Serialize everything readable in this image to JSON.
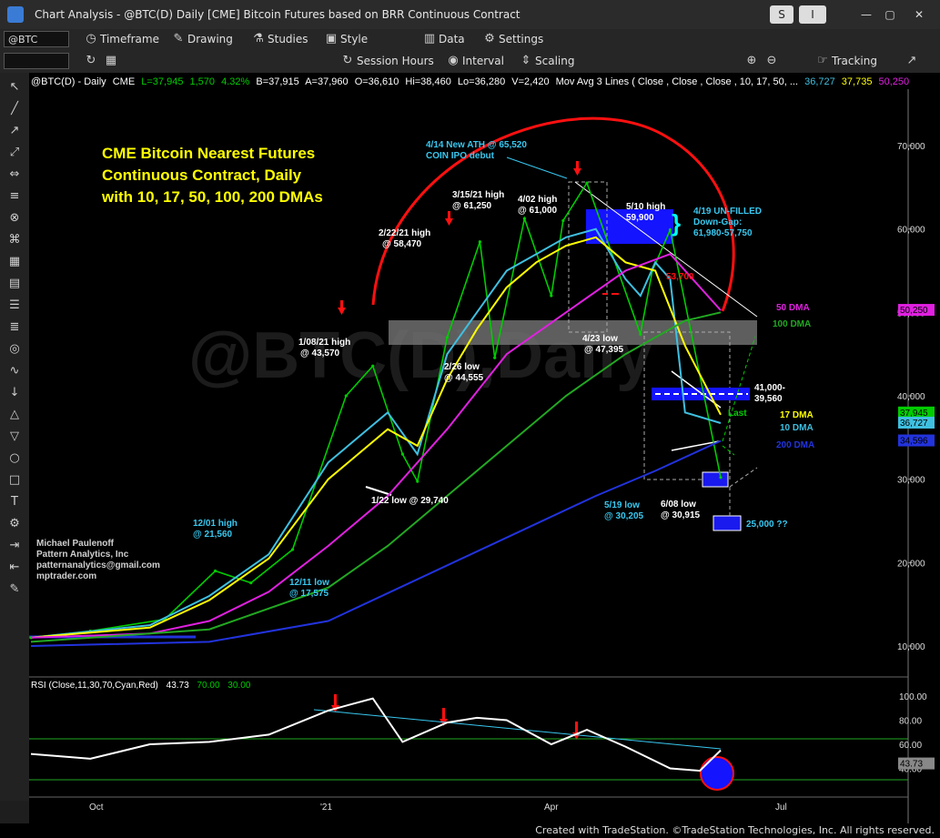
{
  "window": {
    "title": "Chart Analysis - @BTC(D) Daily [CME] Bitcoin Futures based on BRR Continuous Contract",
    "buttons": [
      "S",
      "I"
    ]
  },
  "toolbar1": {
    "symbol": "@BTC",
    "items": [
      "Timeframe",
      "Drawing",
      "Studies",
      "Style",
      "Data",
      "Settings"
    ]
  },
  "toolbar2": {
    "items": [
      "Session Hours",
      "Interval",
      "Scaling",
      "Tracking"
    ]
  },
  "header": {
    "symbol": "@BTC(D) - Daily",
    "exchange": "CME",
    "last": "L=37,945",
    "change": "1,570",
    "pct": "4.32%",
    "bid": "B=37,915",
    "ask": "A=37,960",
    "open": "O=36,610",
    "high": "Hi=38,460",
    "low": "Lo=36,280",
    "vol": "V=2,420",
    "ma_label": "Mov Avg 3 Lines ( Close , Close , Close , 10, 17, 50, ...",
    "ma_vals": [
      "36,727",
      "37,735",
      "50,250"
    ]
  },
  "watermark": "@BTC(D),Daily",
  "colors": {
    "background": "#000000",
    "price": "#00cc00",
    "ma10": "#3fbfe0",
    "ma17": "#ffff00",
    "ma50": "#e020e0",
    "ma100": "#22a822",
    "ma200": "#2233dd",
    "arc": "#ff0000",
    "annotation_white": "#ffffff",
    "annotation_cyan": "#38c8f0",
    "title_yellow": "#ffff00"
  },
  "chart_title": [
    "CME Bitcoin Nearest Futures",
    "Continuous Contract, Daily",
    "with 10, 17, 50, 100, 200 DMAs"
  ],
  "credits": [
    "Michael Paulenoff",
    "Pattern Analytics, Inc",
    "patternanalytics@gmail.com",
    "mptrader.com"
  ],
  "annotations": {
    "ath": [
      "4/14 New ATH @ 65,520",
      "COIN IPO debut"
    ],
    "h0315": [
      "3/15/21 high",
      "@ 61,250"
    ],
    "h0402": [
      "4/02 high",
      "@ 61,000"
    ],
    "h0222": [
      "2/22/21 high",
      "@ 58,470"
    ],
    "h0510": [
      "5/10 high",
      "59,900"
    ],
    "gap": [
      "4/19 UN-FILLED",
      "Down-Gap:",
      "61,980-57,750"
    ],
    "h0108": [
      "1/08/21 high",
      "@ 43,570"
    ],
    "l0226": [
      "2/26 low",
      "@ 44,555"
    ],
    "l0423": [
      "4/23 low",
      "@ 47,395"
    ],
    "l0122": "1/22 low @ 29,740",
    "h1201": [
      "12/01 high",
      "@ 21,560"
    ],
    "l1211": [
      "12/11 low",
      "@ 17,575"
    ],
    "l0519": [
      "5/19 low",
      "@ 30,205"
    ],
    "l0608": [
      "6/08 low",
      "@ 30,915"
    ],
    "box_41k": [
      "41,000-",
      "39,560"
    ],
    "target": "25,000 ??",
    "level_53700": "53,700",
    "last": "Last",
    "dma50": "50 DMA",
    "dma100": "100 DMA",
    "dma17": "17 DMA",
    "dma10": "10 DMA",
    "dma200": "200 DMA"
  },
  "rsi": {
    "label": "RSI (Close,11,30,70,Cyan,Red)",
    "value": "43.73",
    "ob": "70.00",
    "os": "30.00"
  },
  "footer": "Created with TradeStation. ©TradeStation Technologies, Inc. All rights reserved.",
  "chart_data": {
    "type": "line",
    "y_axis": {
      "ticks": [
        10000,
        20000,
        30000,
        40000,
        50000,
        60000,
        70000
      ],
      "tick_labels": [
        "10,000",
        "20,000",
        "30,000",
        "40,000",
        "50,000",
        "60,000",
        "70,000"
      ]
    },
    "x_axis": {
      "tick_labels": [
        "Oct",
        "'21",
        "Apr",
        "Jul"
      ]
    },
    "price_tags": [
      {
        "label": "50,250",
        "value": 50250,
        "color": "#e020e0"
      },
      {
        "label": "37,945",
        "value": 37945,
        "color": "#00cc00"
      },
      {
        "label": "36,727",
        "value": 36727,
        "color": "#3fbfe0"
      },
      {
        "label": "34,596",
        "value": 34596,
        "color": "#2233dd"
      }
    ],
    "rsi_axis": {
      "ticks": [
        40,
        60,
        80,
        100
      ],
      "tick_labels": [
        "40.00",
        "60.00",
        "80.00",
        "100.00"
      ]
    },
    "series": [
      {
        "name": "Price",
        "x": [
          0,
          20,
          45,
          62,
          74,
          88,
          106,
          115,
          125,
          130,
          140,
          151,
          156,
          166,
          175,
          179,
          187,
          205,
          209,
          215,
          232
        ],
        "y": [
          11000,
          11800,
          13200,
          19000,
          17575,
          21560,
          40000,
          43570,
          33000,
          29740,
          47000,
          58470,
          44555,
          61250,
          52000,
          61000,
          65520,
          47395,
          55000,
          59900,
          30205
        ]
      },
      {
        "name": "10 DMA",
        "x": [
          0,
          40,
          60,
          80,
          100,
          120,
          130,
          140,
          150,
          160,
          170,
          180,
          190,
          200,
          205,
          210,
          215,
          220,
          232
        ],
        "y": [
          11000,
          12500,
          16000,
          21000,
          32000,
          38000,
          33000,
          45000,
          50000,
          55000,
          57000,
          59000,
          60000,
          54000,
          52000,
          56000,
          54000,
          38000,
          36727
        ]
      },
      {
        "name": "17 DMA",
        "x": [
          0,
          40,
          60,
          80,
          100,
          120,
          130,
          140,
          150,
          160,
          170,
          180,
          190,
          200,
          210,
          220,
          232
        ],
        "y": [
          11000,
          12200,
          15500,
          20500,
          30000,
          36000,
          34000,
          42000,
          48000,
          53000,
          56000,
          58000,
          59000,
          56000,
          55000,
          46000,
          37735
        ]
      },
      {
        "name": "50 DMA",
        "x": [
          0,
          40,
          60,
          80,
          100,
          120,
          140,
          160,
          180,
          200,
          215,
          232
        ],
        "y": [
          11000,
          11500,
          13000,
          16500,
          22000,
          28000,
          36000,
          45000,
          50000,
          55000,
          57000,
          50250
        ]
      },
      {
        "name": "100 DMA",
        "x": [
          0,
          60,
          100,
          120,
          140,
          160,
          180,
          200,
          220,
          232
        ],
        "y": [
          10500,
          12000,
          17000,
          22000,
          28000,
          34000,
          40000,
          45000,
          49000,
          50000
        ]
      },
      {
        "name": "200 DMA",
        "x": [
          0,
          60,
          100,
          130,
          160,
          190,
          210,
          232
        ],
        "y": [
          10000,
          10500,
          13000,
          18000,
          23000,
          28000,
          31000,
          34596
        ]
      },
      {
        "name": "RSI",
        "x": [
          0,
          20,
          40,
          60,
          80,
          100,
          115,
          125,
          140,
          150,
          160,
          175,
          187,
          200,
          215,
          225,
          232
        ],
        "y": [
          52,
          48,
          60,
          62,
          68,
          88,
          98,
          62,
          78,
          82,
          80,
          60,
          72,
          58,
          40,
          38,
          55
        ]
      }
    ]
  }
}
